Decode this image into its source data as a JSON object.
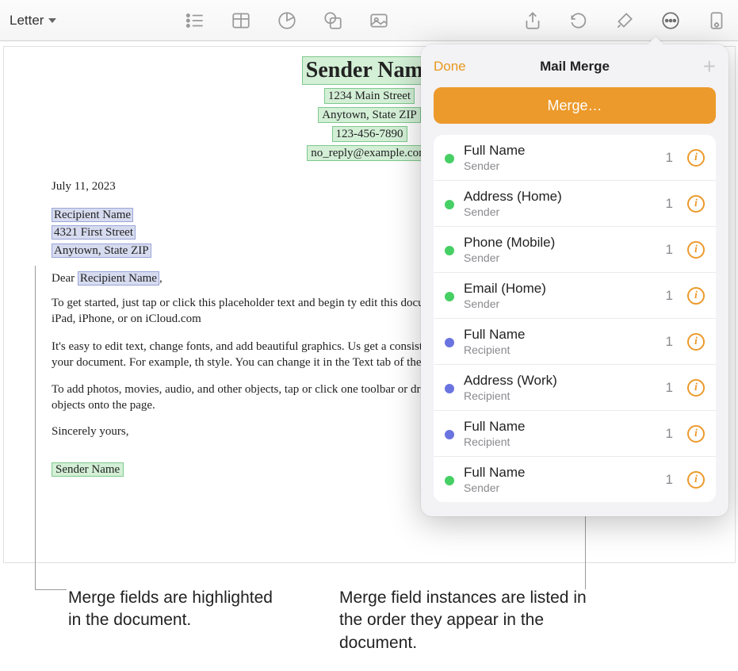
{
  "toolbar": {
    "style_name": "Letter"
  },
  "document": {
    "sender_name": "Sender Name",
    "sender_street": "1234 Main Street",
    "sender_citystate": "Anytown, State ZIP",
    "sender_phone": "123-456-7890",
    "sender_email": "no_reply@example.com",
    "date": "July 11, 2023",
    "recipient_name": "Recipient Name",
    "recipient_street": "4321 First Street",
    "recipient_citystate": "Anytown, State ZIP",
    "salutation_prefix": "Dear ",
    "salutation_name": "Recipient Name",
    "salutation_suffix": ",",
    "para1": "To get started, just tap or click this placeholder text and begin ty edit this document on your Mac, iPad, iPhone, or on iCloud.com",
    "para2": "It's easy to edit text, change fonts, and add beautiful graphics. Us get a consistent look throughout your document. For example, th style. You can change it in the Text tab of the Format controls.",
    "para3": "To add photos, movies, audio, and other objects, tap or click one toolbar or drag and drop the objects onto the page.",
    "signoff": "Sincerely yours,",
    "signature": "Sender Name"
  },
  "popover": {
    "done": "Done",
    "title": "Mail Merge",
    "add": "+",
    "merge_button": "Merge…",
    "fields": [
      {
        "name": "Full Name",
        "sub": "Sender",
        "count": "1",
        "dot": "green"
      },
      {
        "name": "Address (Home)",
        "sub": "Sender",
        "count": "1",
        "dot": "green"
      },
      {
        "name": "Phone (Mobile)",
        "sub": "Sender",
        "count": "1",
        "dot": "green"
      },
      {
        "name": "Email (Home)",
        "sub": "Sender",
        "count": "1",
        "dot": "green"
      },
      {
        "name": "Full Name",
        "sub": "Recipient",
        "count": "1",
        "dot": "blue"
      },
      {
        "name": "Address (Work)",
        "sub": "Recipient",
        "count": "1",
        "dot": "blue"
      },
      {
        "name": "Full Name",
        "sub": "Recipient",
        "count": "1",
        "dot": "blue"
      },
      {
        "name": "Full Name",
        "sub": "Sender",
        "count": "1",
        "dot": "green"
      }
    ]
  },
  "callouts": {
    "left": "Merge fields are highlighted in the document.",
    "right": "Merge field instances are listed in the order they appear in the document."
  }
}
